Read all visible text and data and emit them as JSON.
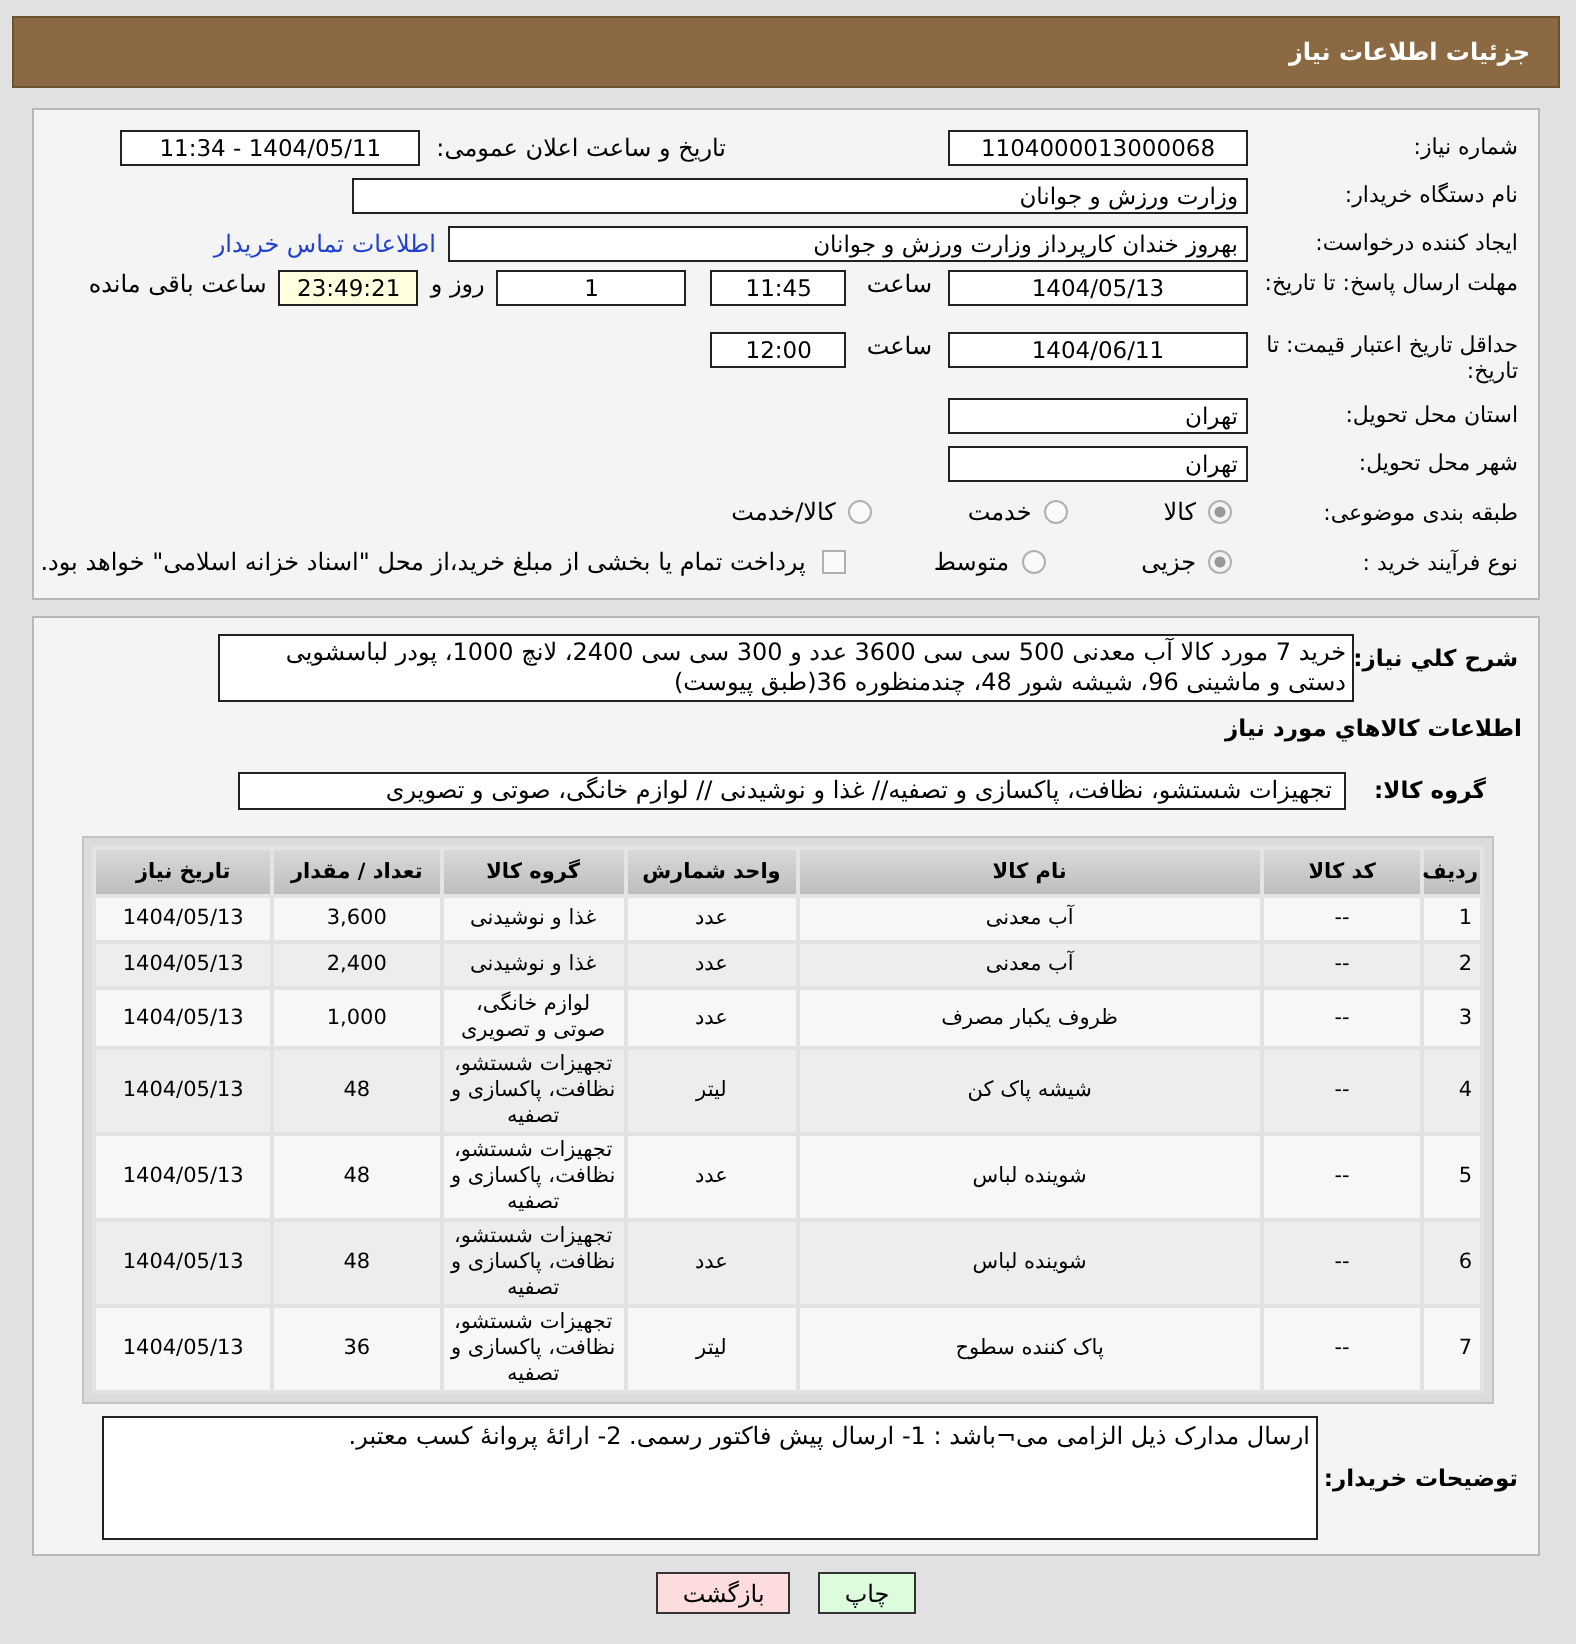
{
  "header": {
    "title": "جزئیات اطلاعات نیاز"
  },
  "need_number": {
    "label": "شماره نیاز:",
    "value": "1104000013000068"
  },
  "announce": {
    "label": "تاریخ و ساعت اعلان عمومی:",
    "value": "1404/05/11 - 11:34"
  },
  "buyer_org": {
    "label": "نام دستگاه خریدار:",
    "value": "وزارت ورزش و جوانان"
  },
  "requester": {
    "label": "ایجاد کننده درخواست:",
    "value": "بهروز  خندان  کارپرداز وزارت ورزش و جوانان",
    "link": "اطلاعات تماس خریدار"
  },
  "deadline": {
    "label": "مهلت ارسال پاسخ: تا تاریخ:",
    "date": "1404/05/13",
    "time_label": "ساعت",
    "time": "11:45",
    "days": "1",
    "days_label": "روز و",
    "remaining": "23:49:21",
    "remaining_label": "ساعت باقی مانده"
  },
  "validity": {
    "label": "حداقل تاریخ اعتبار قیمت: تا تاریخ:",
    "date": "1404/06/11",
    "time_label": "ساعت",
    "time": "12:00"
  },
  "province": {
    "label": "استان محل تحویل:",
    "value": "تهران"
  },
  "city": {
    "label": "شهر محل تحویل:",
    "value": "تهران"
  },
  "category": {
    "label": "طبقه بندی موضوعی:",
    "options": [
      {
        "label": "کالا",
        "selected": true
      },
      {
        "label": "خدمت",
        "selected": false
      },
      {
        "label": "کالا/خدمت",
        "selected": false
      }
    ]
  },
  "process": {
    "label": "نوع فرآیند خرید :",
    "options": [
      {
        "label": "جزیی",
        "selected": true
      },
      {
        "label": "متوسط",
        "selected": false
      }
    ],
    "payment": {
      "checked": false,
      "text": "پرداخت تمام یا بخشی از مبلغ خرید،از محل \"اسناد خزانه اسلامی\" خواهد بود."
    }
  },
  "description": {
    "label": "شرح کلي نياز:",
    "value": "خرید 7 مورد کالا آب معدنی 500 سی سی  3600 عدد و 300 سی سی 2400، لانچ 1000، پودر لباسشویی دستی و ماشینی 96، شیشه شور 48، چندمنظوره 36(طبق پیوست)"
  },
  "goods_title": "اطلاعات کالاهاي مورد نياز",
  "goods_group": {
    "label": "گروه کالا:",
    "value": "تجهیزات شستشو، نظافت، پاکسازی و تصفیه// غذا و نوشیدنی // لوازم خانگی، صوتی و تصویری"
  },
  "table": {
    "columns": [
      "ردیف",
      "کد کالا",
      "نام کالا",
      "واحد شمارش",
      "گروه کالا",
      "تعداد / مقدار",
      "تاریخ نیاز"
    ],
    "rows": [
      [
        "1",
        "--",
        "آب معدنی",
        "عدد",
        "غذا و نوشیدنی",
        "3,600",
        "1404/05/13"
      ],
      [
        "2",
        "--",
        "آب معدنی",
        "عدد",
        "غذا و نوشیدنی",
        "2,400",
        "1404/05/13"
      ],
      [
        "3",
        "--",
        "ظروف یکبار مصرف",
        "عدد",
        "لوازم خانگی، صوتی و تصویری",
        "1,000",
        "1404/05/13"
      ],
      [
        "4",
        "--",
        "شیشه پاک کن",
        "لیتر",
        "تجهیزات شستشو، نظافت، پاکسازی و تصفیه",
        "48",
        "1404/05/13"
      ],
      [
        "5",
        "--",
        "شوینده لباس",
        "عدد",
        "تجهیزات شستشو، نظافت، پاکسازی و تصفیه",
        "48",
        "1404/05/13"
      ],
      [
        "6",
        "--",
        "شوینده لباس",
        "عدد",
        "تجهیزات شستشو، نظافت، پاکسازی و تصفیه",
        "48",
        "1404/05/13"
      ],
      [
        "7",
        "--",
        "پاک کننده سطوح",
        "لیتر",
        "تجهیزات شستشو، نظافت، پاکسازی و تصفیه",
        "36",
        "1404/05/13"
      ]
    ]
  },
  "buyer_notes": {
    "label": "توضیحات خریدار:",
    "value": "ارسال مدارک ذیل الزامی می¬باشد : 1- ارسال پیش فاکتور رسمی. 2- ارائهٔ پروانهٔ کسب معتبر."
  },
  "buttons": [
    {
      "label": "چاپ",
      "kind": "print"
    },
    {
      "label": "بازگشت",
      "kind": "back"
    }
  ]
}
